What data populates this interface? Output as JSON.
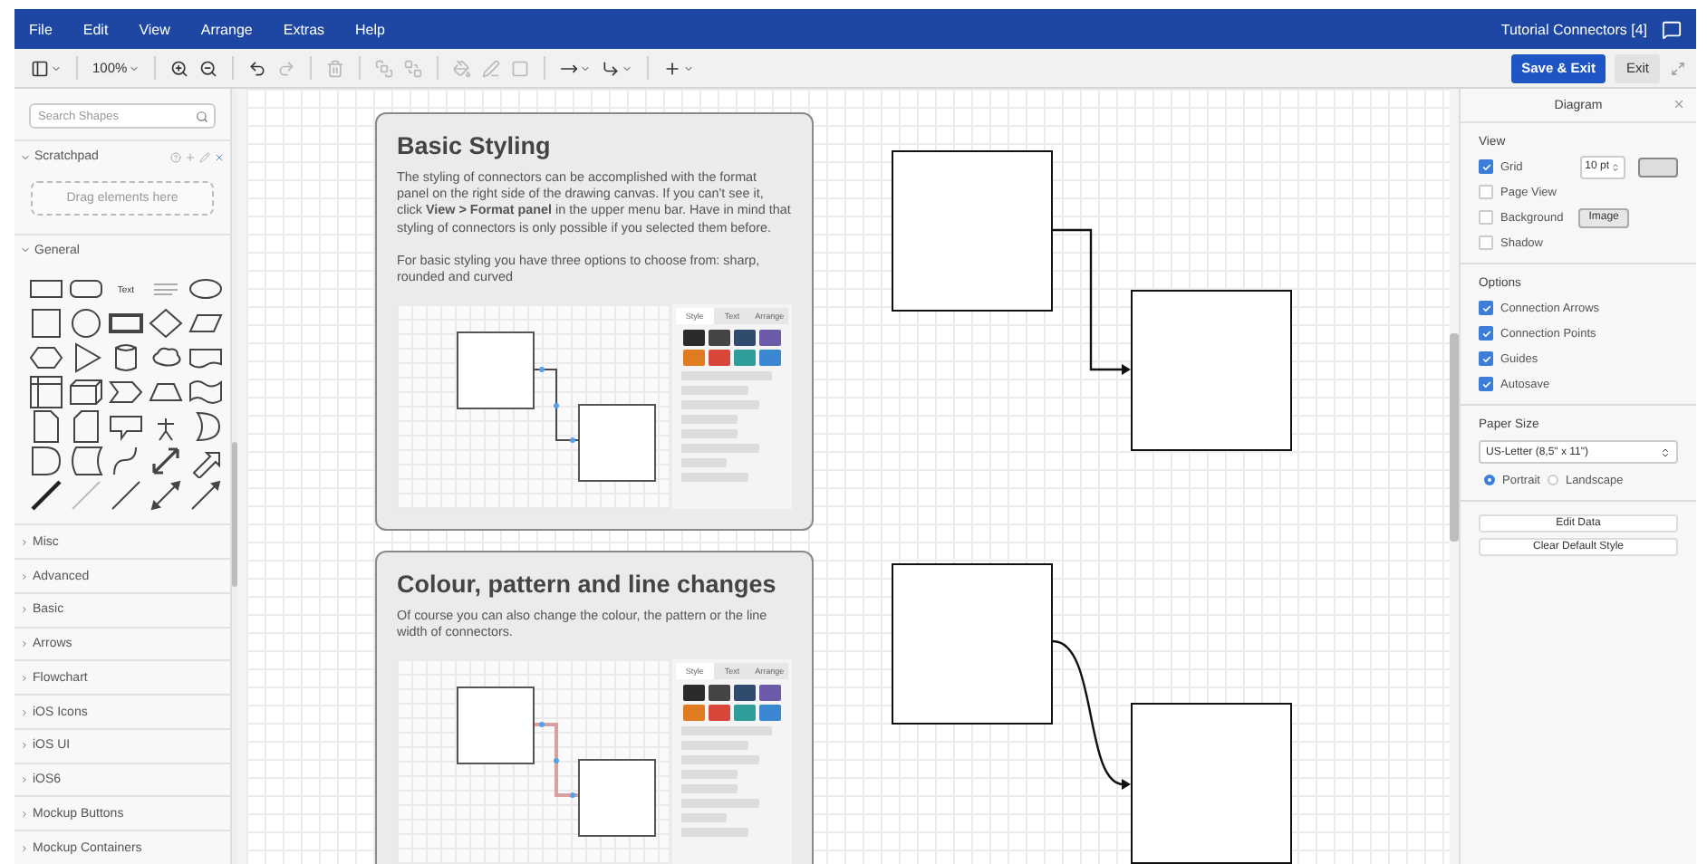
{
  "menu_bar": {
    "items": [
      "File",
      "Edit",
      "View",
      "Arrange",
      "Extras",
      "Help"
    ],
    "document_title": "Tutorial Connectors [4]"
  },
  "toolbar": {
    "items": [
      {
        "kind": "layout",
        "disabled": false
      },
      {
        "kind": "separator"
      },
      {
        "kind": "zoom",
        "label": "100%",
        "disabled": false
      },
      {
        "kind": "separator"
      },
      {
        "kind": "zoom_in",
        "disabled": false
      },
      {
        "kind": "zoom_out",
        "disabled": false
      },
      {
        "kind": "separator"
      },
      {
        "kind": "undo",
        "disabled": false
      },
      {
        "kind": "redo",
        "disabled": true
      },
      {
        "kind": "separator"
      },
      {
        "kind": "delete",
        "disabled": true
      },
      {
        "kind": "separator"
      },
      {
        "kind": "to_front",
        "disabled": true
      },
      {
        "kind": "to_back",
        "disabled": true
      },
      {
        "kind": "separator"
      },
      {
        "kind": "fill",
        "disabled": true
      },
      {
        "kind": "line",
        "disabled": true
      },
      {
        "kind": "shadow",
        "disabled": true
      },
      {
        "kind": "separator"
      },
      {
        "kind": "connection",
        "disabled": false
      },
      {
        "kind": "waypoints",
        "disabled": false
      },
      {
        "kind": "separator"
      },
      {
        "kind": "insert",
        "disabled": false
      }
    ],
    "save_button": "Save & Exit",
    "exit_button": "Exit"
  },
  "sidebar": {
    "search": {
      "placeholder": "Search Shapes"
    },
    "scratchpad": {
      "title": "Scratchpad",
      "expanded": true,
      "drop_hint": "Drag elements here"
    },
    "general": {
      "title": "General",
      "expanded": true,
      "text_shape_label": "Text"
    },
    "categories": [
      {
        "label": "Misc",
        "expanded": false
      },
      {
        "label": "Advanced",
        "expanded": false
      },
      {
        "label": "Basic",
        "expanded": false
      },
      {
        "label": "Arrows",
        "expanded": false
      },
      {
        "label": "Flowchart",
        "expanded": false
      },
      {
        "label": "iOS Icons",
        "expanded": false
      },
      {
        "label": "iOS UI",
        "expanded": false
      },
      {
        "label": "iOS6",
        "expanded": false
      },
      {
        "label": "Mockup Buttons",
        "expanded": false
      },
      {
        "label": "Mockup Containers",
        "expanded": false
      }
    ]
  },
  "canvas": {
    "cards": [
      {
        "title": "Basic Styling",
        "paragraphs": [
          "The styling of connectors can be accomplished with the format panel on the right side of the drawing canvas. If you can't see it, click **View > Format panel** in the upper menu bar. Have in mind that styling of connectors is only possible if you selected them before.",
          "For basic styling you have three options to choose from: sharp, rounded and curved"
        ],
        "color": "#4a4a4a",
        "panel_tabs": [
          "Style",
          "Text",
          "Arrange"
        ]
      },
      {
        "title": "Colour, pattern and line changes",
        "paragraphs": [
          "Of course you can also change the colour, the pattern or the line width of connectors."
        ],
        "color": "#d9a0a0",
        "panel_tabs": [
          "Style",
          "Text",
          "Arrange"
        ]
      }
    ],
    "palette": [
      {
        "color": "#2b2b2b"
      },
      {
        "color": "#444444"
      },
      {
        "color": "#2f4b6e"
      },
      {
        "color": "#6a5aa8"
      },
      {
        "color": "#e07b22"
      },
      {
        "color": "#d9473a"
      },
      {
        "color": "#2f9e9a"
      },
      {
        "color": "#3a86d0"
      }
    ],
    "examples": [
      {
        "kind": "sharp"
      },
      {
        "kind": "curved"
      }
    ]
  },
  "format_panel": {
    "title": "Diagram",
    "view": {
      "title": "View",
      "options": [
        {
          "label": "Grid",
          "checked": true
        },
        {
          "label": "Page View",
          "checked": false
        },
        {
          "label": "Background",
          "checked": false
        },
        {
          "label": "Shadow",
          "checked": false
        }
      ],
      "grid_size": "10 pt",
      "image_button": "Image"
    },
    "options": {
      "title": "Options",
      "items": [
        {
          "label": "Connection Arrows",
          "checked": true
        },
        {
          "label": "Connection Points",
          "checked": true
        },
        {
          "label": "Guides",
          "checked": true
        },
        {
          "label": "Autosave",
          "checked": true
        }
      ]
    },
    "paper_size": {
      "title": "Paper Size",
      "value": "US-Letter (8,5\" x 11\")",
      "orientations": [
        {
          "label": "Portrait",
          "selected": true
        },
        {
          "label": "Landscape",
          "selected": false
        }
      ]
    },
    "buttons": [
      "Edit Data",
      "Clear Default Style"
    ]
  }
}
